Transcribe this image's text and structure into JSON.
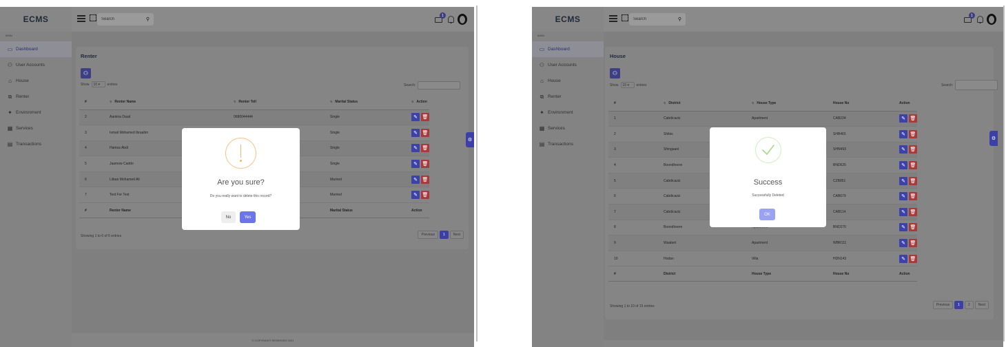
{
  "app": {
    "brand": "ECMS",
    "search_placeholder": "Search",
    "cart_badge": "1",
    "sidebar_section": "MAIN",
    "footer": "© COPYRIGHT RESERVED 2021"
  },
  "sidebar": {
    "items": [
      {
        "label": "Dashboard",
        "icon": "monitor-icon",
        "glyph": "▭"
      },
      {
        "label": "User Accounts",
        "icon": "users-icon",
        "glyph": "⚇"
      },
      {
        "label": "House",
        "icon": "home-icon",
        "glyph": "⌂"
      },
      {
        "label": "Renter",
        "icon": "copy-icon",
        "glyph": "⧉"
      },
      {
        "label": "Environment",
        "icon": "sun-icon",
        "glyph": "✦"
      },
      {
        "label": "Services",
        "icon": "building-icon",
        "glyph": "▦"
      },
      {
        "label": "Transactions",
        "icon": "grid-icon",
        "glyph": "▤"
      }
    ]
  },
  "renter_page": {
    "card_title": "Renter",
    "show_label": "Show",
    "entries_value": "10",
    "entries_label": "entries",
    "search_label": "Search:",
    "columns": [
      "#",
      "Renter Name",
      "Renter Tell",
      "Marital Status",
      "Action"
    ],
    "rows": [
      {
        "id": "2",
        "name": "Aamina Daud",
        "tell": "0680044444",
        "status": "Single"
      },
      {
        "id": "3",
        "name": "Ismail Mohamed Ibraahin",
        "tell": "",
        "status": "Single"
      },
      {
        "id": "4",
        "name": "Hamsa Abdi",
        "tell": "",
        "status": "Single"
      },
      {
        "id": "5",
        "name": "Jaamow Caddo",
        "tell": "",
        "status": "Single"
      },
      {
        "id": "6",
        "name": "Liiban Mohamed Ali",
        "tell": "",
        "status": "Married"
      },
      {
        "id": "7",
        "name": "Test For Test",
        "tell": "",
        "status": "Married"
      }
    ],
    "info": "Showing 1 to 6 of 6 entries",
    "pager": [
      "Previous",
      "1",
      "Next"
    ]
  },
  "confirm_modal": {
    "title": "Are you sure?",
    "text": "Do you really want to delete this record?",
    "no_label": "No",
    "yes_label": "Yes"
  },
  "house_page": {
    "card_title": "House",
    "show_label": "Show",
    "entries_value": "10",
    "entries_label": "entries",
    "search_label": "Search:",
    "columns": [
      "#",
      "District",
      "House Type",
      "House No",
      "Action"
    ],
    "rows": [
      {
        "id": "1",
        "district": "Cabdicaziz",
        "type": "Apartment",
        "no": "CAB234"
      },
      {
        "id": "2",
        "district": "Shibis",
        "type": "",
        "no": "SHB465"
      },
      {
        "id": "3",
        "district": "Shingaani",
        "type": "",
        "no": "SHN493"
      },
      {
        "id": "4",
        "district": "Boondheere",
        "type": "",
        "no": "BND625"
      },
      {
        "id": "5",
        "district": "Cabdicaziz",
        "type": "",
        "no": "CZB851"
      },
      {
        "id": "6",
        "district": "Cabdicaziz",
        "type": "",
        "no": "CAB679"
      },
      {
        "id": "7",
        "district": "Cabdicaziz",
        "type": "",
        "no": "CAB114"
      },
      {
        "id": "8",
        "district": "Boondheere",
        "type": "Apartment",
        "no": "BND270"
      },
      {
        "id": "9",
        "district": "Waaberi",
        "type": "Apartment",
        "no": "WBR111"
      },
      {
        "id": "10",
        "district": "Hodan",
        "type": "Villa",
        "no": "HDN143"
      }
    ],
    "info": "Showing 1 to 10 of 15 entries",
    "pager": [
      "Previous",
      "1",
      "2",
      "Next"
    ]
  },
  "success_modal": {
    "title": "Success",
    "text": "Successfully Deleted",
    "ok_label": "OK"
  },
  "colors": {
    "accent": "#6b74e8",
    "warning": "#f3b86e",
    "success": "#a5dc86",
    "edit": "#3d42a8",
    "delete": "#a83a3a"
  }
}
